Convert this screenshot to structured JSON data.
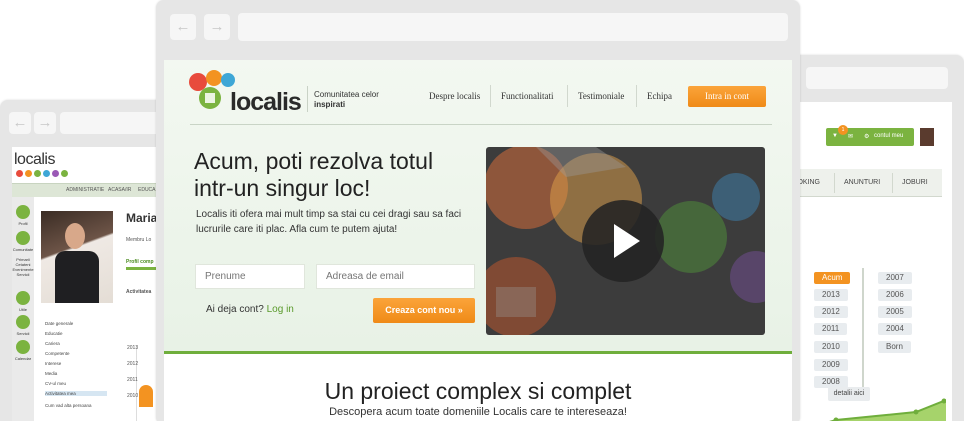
{
  "colors": {
    "brand_green": "#6fae3c",
    "accent_orange": "#f39321"
  },
  "front": {
    "logo_text": "localis",
    "tagline_line1": "Comunitatea celor",
    "tagline_line2": "inspirati",
    "nav": [
      "Despre localis",
      "Functionalitati",
      "Testimoniale",
      "Echipa"
    ],
    "login_button": "Intra in cont",
    "headline_line1": "Acum, poti rezolva totul",
    "headline_line2": "intr-un singur loc!",
    "subtext": "Localis iti ofera mai mult timp sa stai cu cei dragi sau sa faci lucrurile care iti plac. Afla cum te putem ajuta!",
    "first_name_placeholder": "Prenume",
    "email_placeholder": "Adreasa de email",
    "already_account": "Ai deja cont?",
    "login_link": "Log in",
    "create_account_button": "Creaza cont nou  »",
    "section_title": "Un proiect complex si complet",
    "section_subtitle": "Descopera acum toate domeniile Localis care te intereseaza!",
    "video_icon": "play-icon"
  },
  "back_left": {
    "logo_text": "localis",
    "topbar": [
      "ADMINISTRATIE",
      "ACASA/IR",
      "EDUCA"
    ],
    "sidebar": [
      "Profil",
      "Comunitate",
      "Primarii Cetateni Evenimente Servicii",
      "Utile",
      "Servicii",
      "Calendar"
    ],
    "name": "Maria",
    "member_text": "Membru Lo",
    "profile_text": "Profil comp",
    "activity_label": "Activitatea",
    "menu": [
      "Date generale",
      "Educatie",
      "Cariera",
      "Competente",
      "Interese",
      "Media",
      "CV-ul meu",
      "Activitatea mea",
      "Cum vad alta persoana"
    ],
    "years": [
      "2013",
      "2012",
      "2011",
      "2010"
    ]
  },
  "back_right": {
    "badge_count": "1",
    "account_label": "contul meu",
    "tabs": [
      "OOKING",
      "ANUNTURI",
      "JOBURI"
    ],
    "years_left": [
      "Acum",
      "2013",
      "2012",
      "2011",
      "2010",
      "2009",
      "2008"
    ],
    "years_right": [
      "2007",
      "2006",
      "2005",
      "2004",
      "Born"
    ],
    "active_year": "Acum",
    "detail_button": "detalii aici"
  }
}
